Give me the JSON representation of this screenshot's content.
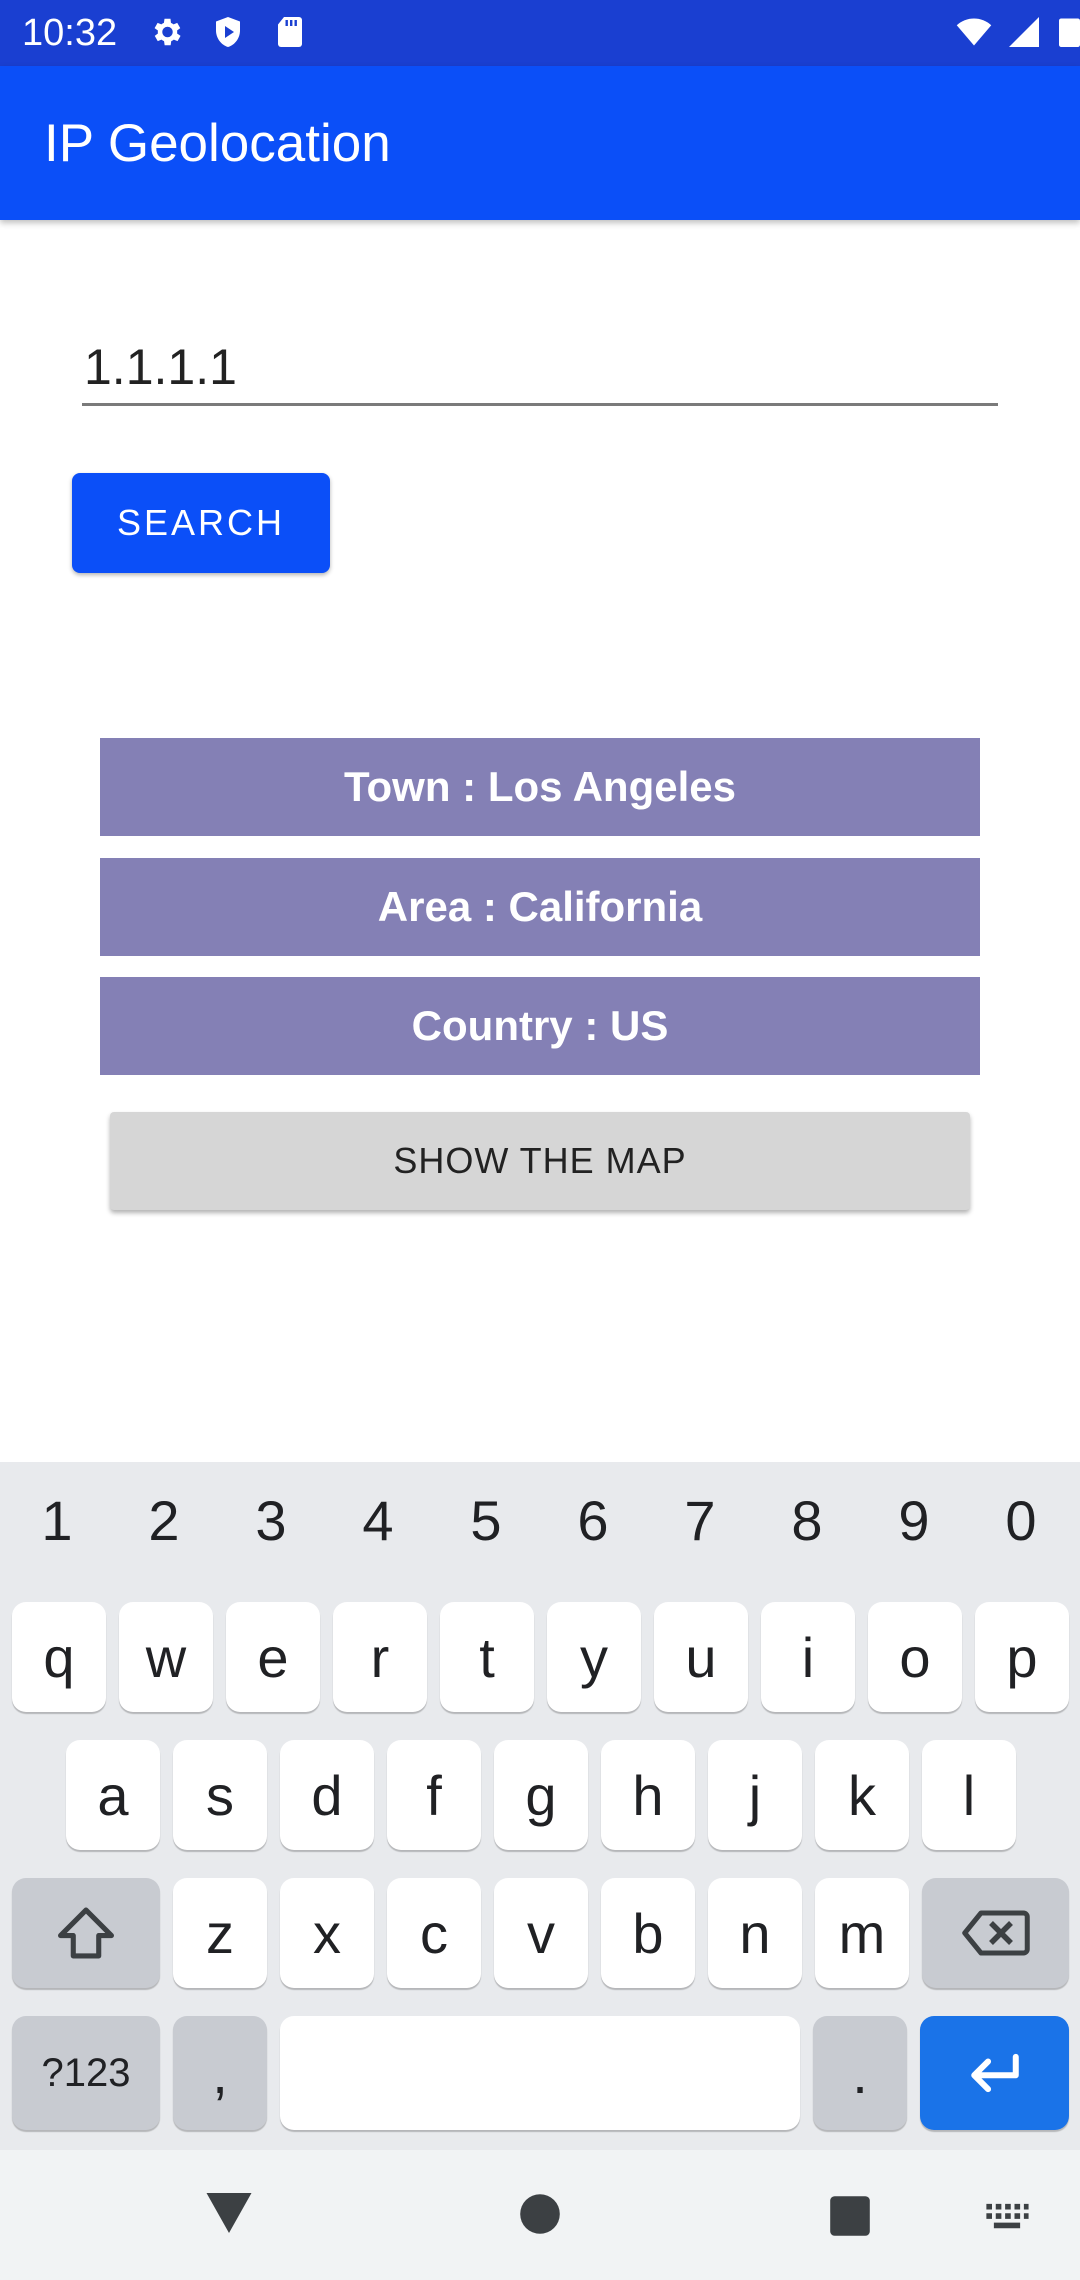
{
  "status_bar": {
    "time": "10:32",
    "left_icons": [
      "gear-icon",
      "shield-icon",
      "sd-card-icon"
    ],
    "right_icons": [
      "wifi-icon",
      "signal-icon",
      "battery-icon"
    ]
  },
  "app_bar": {
    "title": "IP Geolocation",
    "color": "#0b4ff8"
  },
  "search": {
    "ip_value": "1.1.1.1",
    "button_label": "SEARCH"
  },
  "results": {
    "town": "Town : Los Angeles",
    "area": "Area : California",
    "country": "Country : US"
  },
  "map_button_label": "SHOW THE MAP",
  "keyboard": {
    "number_row": [
      "1",
      "2",
      "3",
      "4",
      "5",
      "6",
      "7",
      "8",
      "9",
      "0"
    ],
    "row1": [
      "q",
      "w",
      "e",
      "r",
      "t",
      "y",
      "u",
      "i",
      "o",
      "p"
    ],
    "row2": [
      "a",
      "s",
      "d",
      "f",
      "g",
      "h",
      "j",
      "k",
      "l"
    ],
    "row3": [
      "z",
      "x",
      "c",
      "v",
      "b",
      "n",
      "m"
    ],
    "symbols_label": "?123",
    "comma": ",",
    "period": "."
  },
  "nav_bar": [
    "back-icon",
    "home-icon",
    "recents-icon",
    "keyboard-switch-icon"
  ],
  "colors": {
    "primary": "#0b4ff8",
    "result_box": "#8480b5",
    "keyboard_bg": "#e8eaed",
    "enter": "#1a73e8"
  }
}
